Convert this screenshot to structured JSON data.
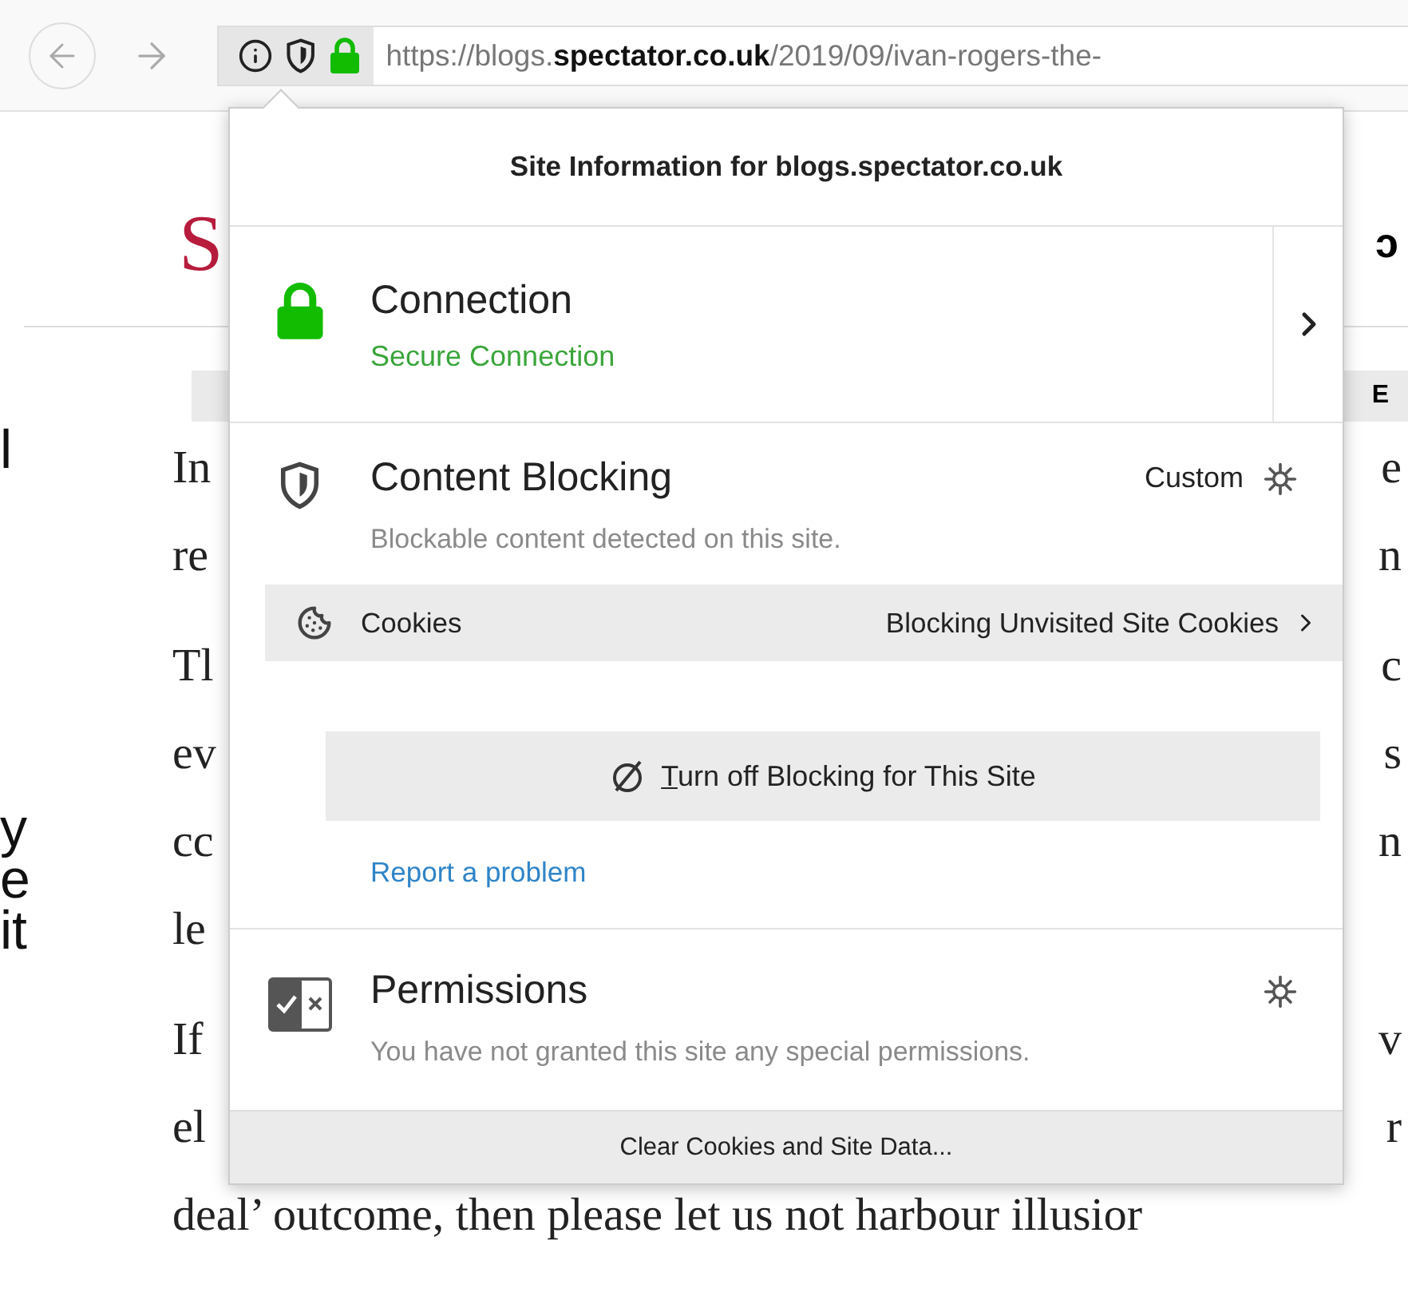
{
  "toolbar": {
    "url": "https://blogs.**spectator.co.uk**/2019/09/ivan-rogers-the-"
  },
  "page": {
    "logo": "S",
    "header_end": "ɔ",
    "band_end": "E",
    "margin_paragraphs": [
      [
        "l"
      ],
      [
        "y",
        "e",
        "it"
      ]
    ],
    "paragraphs": [
      [
        {
          "start": "In",
          "end": "e"
        },
        {
          "start": "re",
          "end": "n"
        }
      ],
      [
        {
          "start": "Tl",
          "end": "c"
        },
        {
          "start": "ev",
          "end": "s"
        },
        {
          "start": "cc",
          "end": "n"
        },
        {
          "start": "le"
        }
      ],
      [
        {
          "start": "If",
          "end": "v"
        },
        {
          "start": "el",
          "end": "r"
        },
        {
          "start": "deal’ outcome, then please let us not harbour illusior"
        }
      ]
    ]
  },
  "popup": {
    "title": "Site Information for blogs.spectator.co.uk",
    "connection": {
      "title": "Connection",
      "status": "Secure Connection"
    },
    "content_blocking": {
      "title": "Content Blocking",
      "mode": "Custom",
      "description": "Blockable content detected on this site.",
      "cookies": {
        "label": "Cookies",
        "value": "Blocking Unvisited Site Cookies"
      },
      "toggle_button": "Turn off Blocking for This Site",
      "report_link": "Report a problem"
    },
    "permissions": {
      "title": "Permissions",
      "description": "You have not granted this site any special permissions."
    },
    "footer_button": "Clear Cookies and Site Data..."
  }
}
